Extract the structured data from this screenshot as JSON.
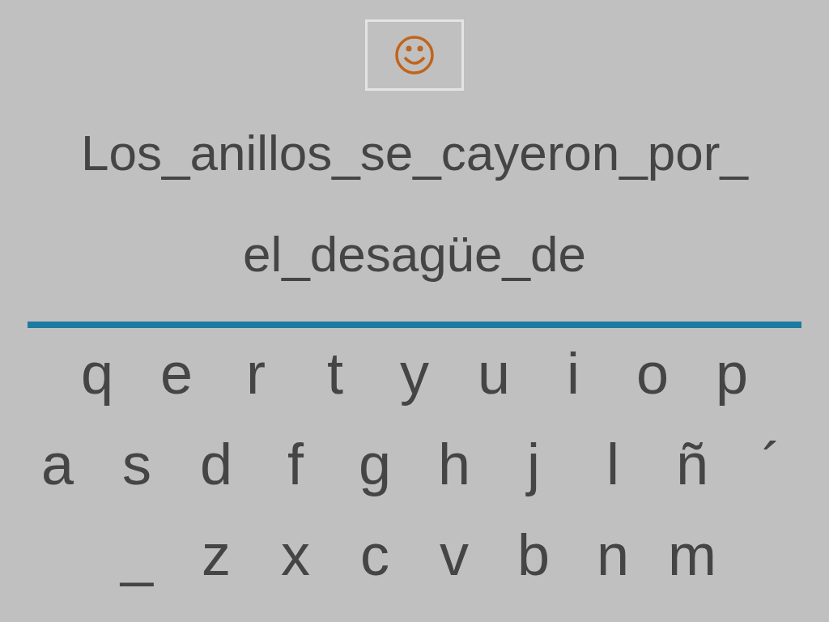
{
  "hint_button": {
    "kind": "smiley"
  },
  "sentence": "Los_anillos_se_cayeron_por_ el_desagüe_de",
  "keyboard": {
    "rows": [
      [
        "q",
        "e",
        "r",
        "t",
        "y",
        "u",
        "i",
        "o",
        "p"
      ],
      [
        "a",
        "s",
        "d",
        "f",
        "g",
        "h",
        "j",
        "l",
        "ñ",
        "´"
      ],
      [
        "_",
        "z",
        "x",
        "c",
        "v",
        "b",
        "n",
        "m"
      ]
    ]
  }
}
